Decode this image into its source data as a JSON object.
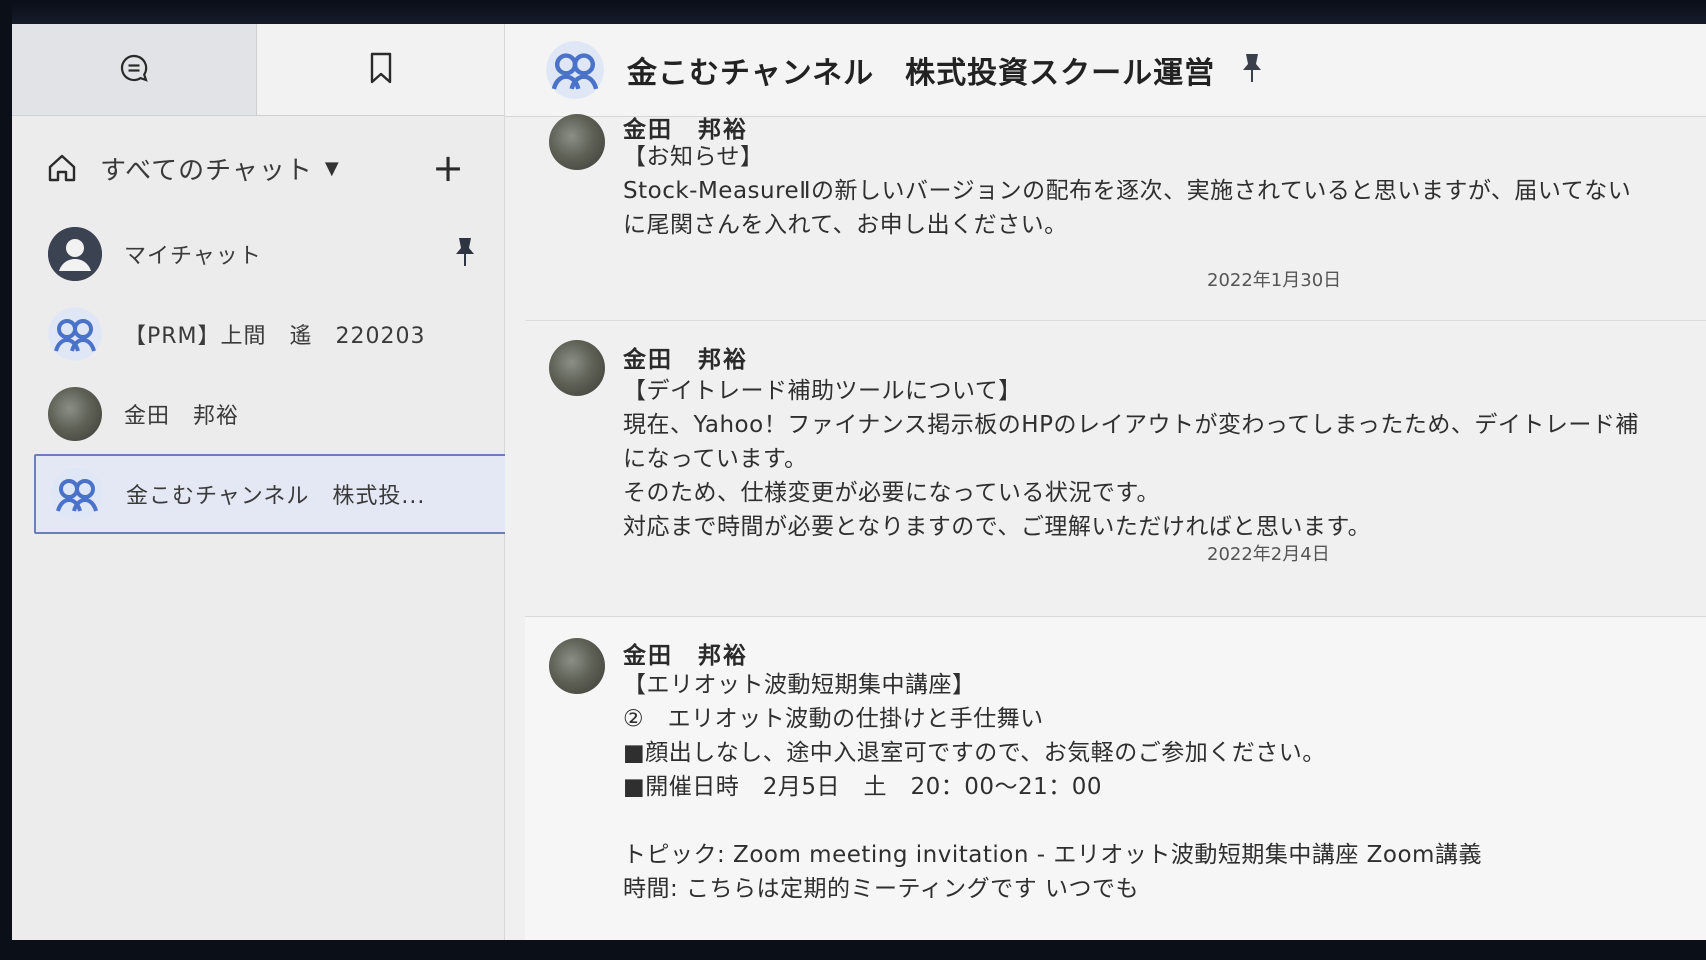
{
  "sidebar": {
    "tabs": [
      {
        "icon": "chat-bubble-icon"
      },
      {
        "icon": "bookmark-icon"
      }
    ],
    "header": {
      "title": "すべてのチャット",
      "caret": "▼",
      "add": "+"
    },
    "chats": [
      {
        "label": "マイチャット",
        "avatar": "person-icon",
        "pinned": true
      },
      {
        "label": "【PRM】上間　遙　220203",
        "avatar": "group-icon"
      },
      {
        "label": "金田　邦裕",
        "avatar": "photo-avatar"
      },
      {
        "label": "金こむチャンネル　株式投...",
        "avatar": "group-icon",
        "selected": true
      }
    ]
  },
  "main": {
    "header": {
      "title": "金こむチャンネル　株式投資スクール運営",
      "pinned": true
    },
    "messages": [
      {
        "sender": "金田　邦裕",
        "lines": [
          "【お知らせ】",
          "Stock-MeasureⅡの新しいバージョンの配布を逐次、実施されていると思いますが、届いてない",
          "に尾関さんを入れて、お申し出ください。"
        ],
        "date": "2022年1月30日"
      },
      {
        "sender": "金田　邦裕",
        "lines": [
          "【デイトレード補助ツールについて】",
          "現在、Yahoo！ファイナンス掲示板のHPのレイアウトが変わってしまったため、デイトレード補",
          "になっています。",
          "そのため、仕様変更が必要になっている状況です。",
          "対応まで時間が必要となりますので、ご理解いただければと思います。"
        ],
        "date": "2022年2月4日"
      },
      {
        "sender": "金田　邦裕",
        "lines": [
          "【エリオット波動短期集中講座】",
          "②　エリオット波動の仕掛けと手仕舞い",
          "■顔出しなし、途中入退室可ですので、お気軽のご参加ください。",
          "■開催日時　2月5日　土　20：00～21：00",
          "",
          "トピック: Zoom meeting invitation - エリオット波動短期集中講座 Zoom講義",
          "時間: こちらは定期的ミーティングです いつでも"
        ]
      }
    ]
  },
  "colors": {
    "selected_bg": "#e4e8f4",
    "selected_border": "#6a7fb7",
    "group_avatar": "#4a72c8"
  }
}
